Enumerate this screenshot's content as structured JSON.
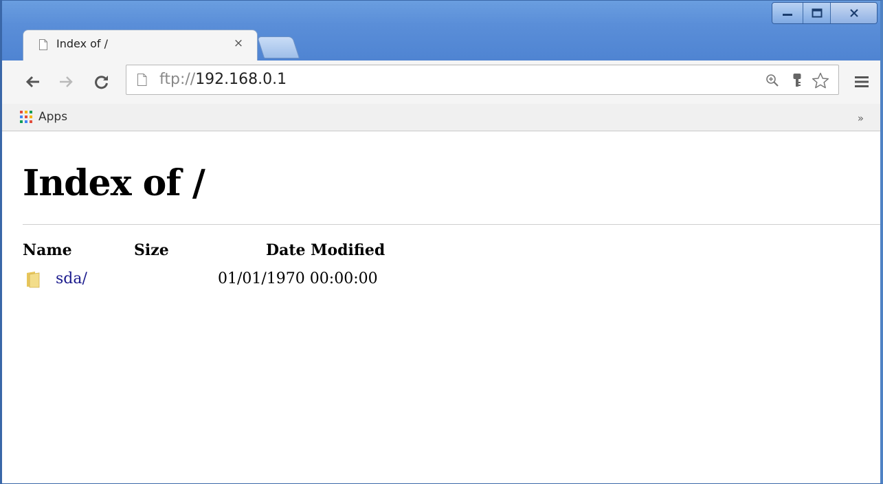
{
  "window": {
    "buttons": [
      "minimize",
      "maximize",
      "close"
    ]
  },
  "tab": {
    "title": "Index of /",
    "close_glyph": "×",
    "icon": "page-icon"
  },
  "toolbar": {
    "url_scheme": "ftp://",
    "url_host": "192.168.0.1",
    "icons": [
      "back-icon",
      "forward-icon",
      "reload-icon",
      "page-icon",
      "zoom-icon",
      "key-icon",
      "star-icon",
      "menu-icon"
    ]
  },
  "bookmarks": {
    "apps_label": "Apps",
    "overflow": "»"
  },
  "page": {
    "title": "Index of /",
    "columns": {
      "name": "Name",
      "size": "Size",
      "date": "Date Modified"
    },
    "entries": [
      {
        "name": "sda/",
        "size": "",
        "date": "01/01/1970 00:00:00"
      }
    ]
  },
  "colors": {
    "titlebar": "#5a8ed8",
    "link": "#1a1a8c",
    "toolbar": "#f5f5f5"
  }
}
